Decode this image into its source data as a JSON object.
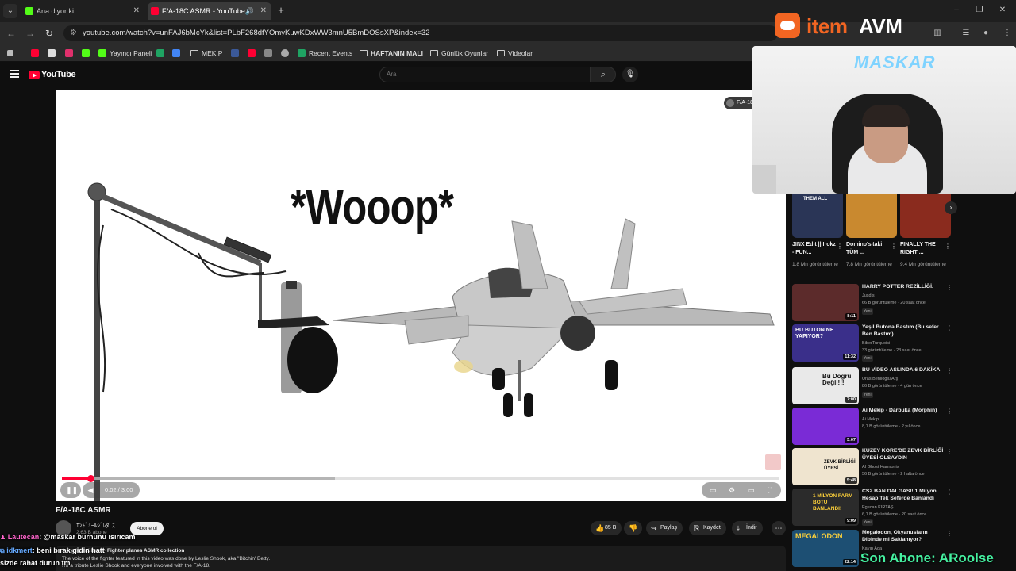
{
  "browser": {
    "tabs": [
      {
        "title": "Ana diyor ki...",
        "fav_color": "#53fc18",
        "active": false
      },
      {
        "title": "F/A-18C ASMR - YouTube",
        "fav_color": "#ff0033",
        "active": true
      }
    ],
    "new_tab": "+",
    "url": "youtube.com/watch?v=unFAJ6bMcYk&list=PLbF268dfYOmyKuwKDxWW3mnU5BmDOSsXP&index=32",
    "bookmarks": [
      {
        "label": "",
        "color": "#ff0033"
      },
      {
        "label": "",
        "color": "#222222"
      },
      {
        "label": "",
        "color": "#e1306c"
      },
      {
        "label": "",
        "color": "#53fc18"
      },
      {
        "label": "Yayıncı Paneli",
        "color": "#53fc18"
      },
      {
        "label": "",
        "color": "#1fa463"
      },
      {
        "label": "",
        "color": "#4285f4"
      },
      {
        "label": "MEKİP",
        "color": "",
        "folder": true
      },
      {
        "label": "",
        "color": "#3b5998"
      },
      {
        "label": "",
        "color": "#ff0033"
      },
      {
        "label": "",
        "color": "#888888"
      },
      {
        "label": "",
        "color": "#aaaaaa"
      },
      {
        "label": "Recent Events",
        "color": "#1fa463"
      },
      {
        "label": "HAFTANIN MALI",
        "color": "",
        "folder": true
      },
      {
        "label": "Günlük Oyunlar",
        "color": "",
        "folder": true
      },
      {
        "label": "Videolar",
        "color": "",
        "folder": true
      }
    ]
  },
  "youtube": {
    "logo_text": "YouTube",
    "search_placeholder": "Ara"
  },
  "player": {
    "overlay_text": "*Wooop*",
    "channel_chip": "F/A-18",
    "time": "0:02 / 3:00",
    "progress_played": 0.04,
    "progress_buffered": 0.38
  },
  "video": {
    "title": "F/A-18C ASMR",
    "channel": "ｴﾝﾄﾞﾐｰﾙｼﾞﾚﾀﾞｽ",
    "subscribers": "2,63 B abone",
    "subscribe": "Abone ol",
    "likes": "85 B",
    "share": "Paylaş",
    "save": "Kaydet",
    "download": "İndir",
    "desc_lines": [
      "1 B görüntüleme · Fighter planes ASMR collection",
      "The voice of the fighter featured in this video was done by Leslie Shook, aka \"Bitchin' Betty.",
      "I'm a tribute Leslie Shook and everyone involved with the F/A-18."
    ]
  },
  "sidebar": {
    "shorts": [
      {
        "title": "JINX Edit || Irokz - FUN...",
        "views": "1,8 Mn görüntüleme",
        "color": "#2a3556",
        "caption": "THEM ALL"
      },
      {
        "title": "Domino's'taki TÜM ...",
        "views": "7,8 Mn görüntüleme",
        "color": "#c9892f",
        "caption": ""
      },
      {
        "title": "FINALLY THE RIGHT ...",
        "views": "9,4 Mn görüntüleme",
        "color": "#8a2b1e",
        "caption": ""
      }
    ],
    "videos": [
      {
        "title": "HARRY POTTER REZİLLİĞİ.",
        "channel": "Jusdis",
        "meta": "66 B görüntüleme · 20 saat önce",
        "new": "Yeni",
        "duration": "8:11",
        "color": "#5c2b2b",
        "thumb_text": ""
      },
      {
        "title": "Yeşil Butona Bastım (Bu sefer Ben Bastım)",
        "channel": "BiberTurquoisi",
        "meta": "33 görüntüleme · 23 saat önce",
        "new": "Yeni",
        "duration": "11:32",
        "color": "#3a2f8a",
        "thumb_text": "BU BUTON NE YAPIYOR?"
      },
      {
        "title": "BU VİDEO ASLINDA 6 DAKİKA!",
        "channel": "Uras Benlioğlu Arş",
        "meta": "86 B görüntüleme · 4 gün önce",
        "new": "Yeni",
        "duration": "7:00",
        "color": "#e9e9e9",
        "thumb_text": "Bu Doğru Değil!!!"
      },
      {
        "title": "Ai Mekip - Darbuka (Morphin)",
        "channel": "Ai Mekip",
        "meta": "8,1 B görüntüleme · 2 yıl önce",
        "new": "",
        "duration": "3:07",
        "color": "#7a2bd6",
        "thumb_text": ""
      },
      {
        "title": "KUZEY KORE'DE ZEVK BİRLİĞİ ÜYESİ OLSAYDIN",
        "channel": "AI Ghost Harmonix",
        "meta": "56 B görüntüleme · 2 hafta önce",
        "new": "",
        "duration": "5:48",
        "color": "#efe4cf",
        "thumb_text": "ZEVK BİRLİĞİ ÜYESİ"
      },
      {
        "title": "CS2 BAN DALGASI! 1 Milyon Hesap Tek Seferde Banlandı",
        "channel": "Egecan KIRTAŞ",
        "meta": "6,1 B görüntüleme · 20 saat önce",
        "new": "Yeni",
        "duration": "9:09",
        "color": "#2b2b2b",
        "thumb_text": "1 MİLYON FARM BOTU BANLANDI!"
      },
      {
        "title": "Megalodon, Okyanusların Dibinde mi Saklanıyor?",
        "channel": "Kayıp Ada",
        "meta": "",
        "new": "",
        "duration": "22:14",
        "color": "#1d4f73",
        "thumb_text": "MEGALODON"
      }
    ]
  },
  "stream": {
    "brand_1": "item",
    "brand_2": "AVM",
    "webcam_sign": "MASKAR",
    "chat": [
      {
        "name": "Lautecan",
        "name_color": "#ff66cc",
        "text": ": @maskar burnunu ısırıcam"
      },
      {
        "name": "idkmert",
        "name_color": "#66aaff",
        "text": ": beni bırak gidin hatt"
      },
      {
        "name": "",
        "name_color": "#ffffff",
        "text": "sizde rahat durun tm"
      }
    ],
    "ticker": "Son Abone: ARoolse"
  }
}
